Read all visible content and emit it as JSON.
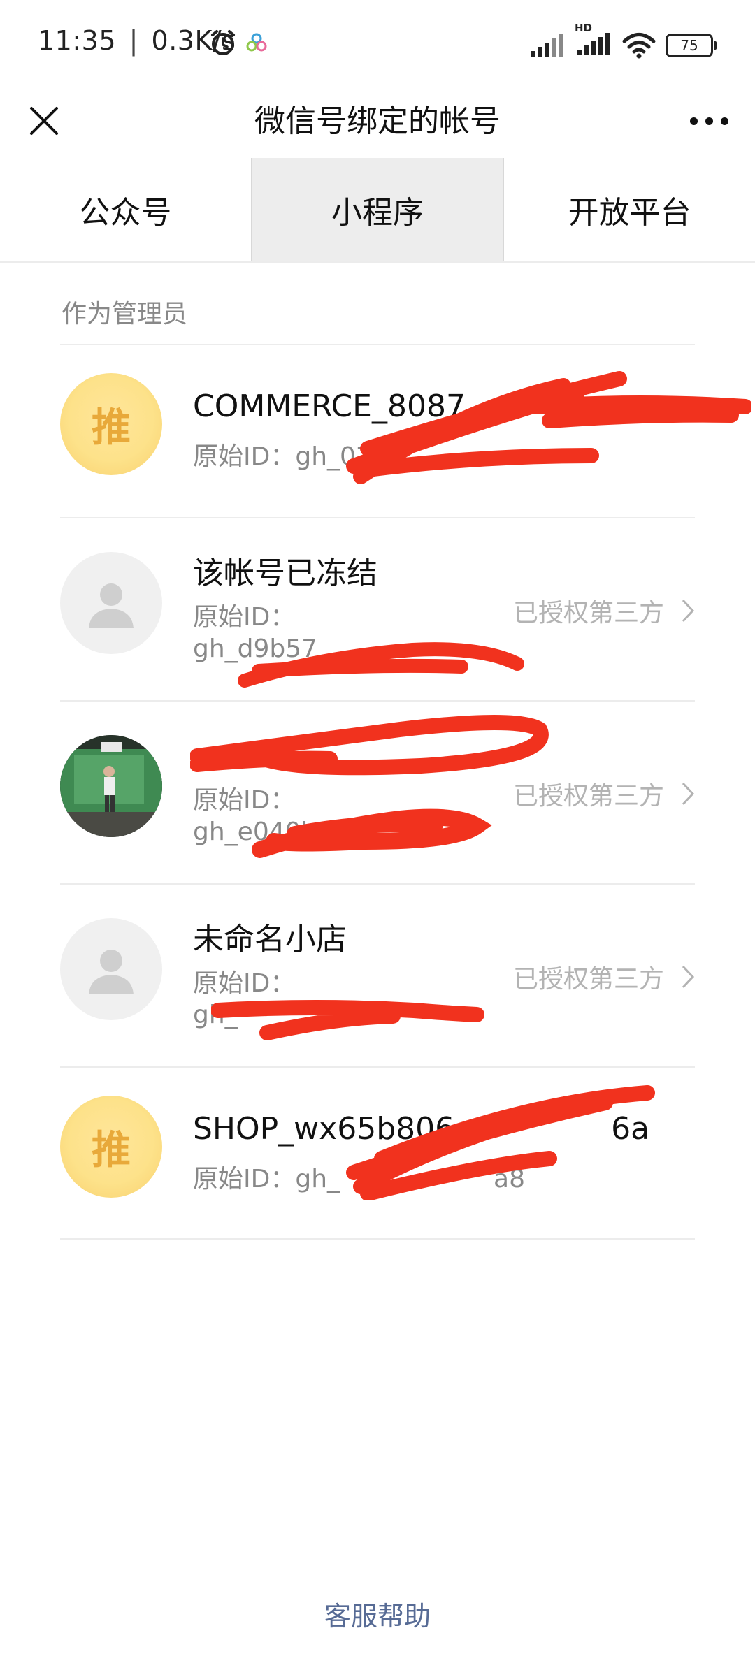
{
  "status_bar": {
    "time": "11:35",
    "speed": "0.3K/s",
    "separator": "|",
    "battery": "75",
    "network_label": "HD",
    "icons": [
      "alarm-icon",
      "cloud-app-icon",
      "signal-icon",
      "hd-signal-icon",
      "wifi-icon",
      "battery-icon"
    ]
  },
  "nav": {
    "title": "微信号绑定的帐号",
    "close_icon": "close-icon",
    "more_icon": "more-icon"
  },
  "tabs": [
    {
      "label": "公众号",
      "active": false
    },
    {
      "label": "小程序",
      "active": true
    },
    {
      "label": "开放平台",
      "active": false
    }
  ],
  "section": {
    "header": "作为管理员"
  },
  "accounts": [
    {
      "name": "COMMERCE_8087",
      "id_label": "原始ID：",
      "id_value": "gh_07",
      "avatar": "推",
      "avatar_type": "tui",
      "status": ""
    },
    {
      "name": "该帐号已冻结",
      "id_label": "原始ID：",
      "id_value": "gh_d9b57",
      "avatar": "",
      "avatar_type": "placeholder",
      "status": "已授权第三方"
    },
    {
      "name": "",
      "id_label": "原始ID：",
      "id_value": "gh_e040b",
      "avatar": "",
      "avatar_type": "photo",
      "status": "已授权第三方"
    },
    {
      "name": "未命名小店",
      "id_label": "原始ID：",
      "id_value": "gh_",
      "avatar": "",
      "avatar_type": "placeholder",
      "status": "已授权第三方"
    },
    {
      "name": "SHOP_wx65b806",
      "name_tail": "6a",
      "id_label": "原始ID：",
      "id_value": "gh_",
      "id_tail": "a8",
      "avatar": "推",
      "avatar_type": "tui",
      "status": ""
    }
  ],
  "footer": {
    "help_link": "客服帮助"
  },
  "colors": {
    "link": "#576b95",
    "secondary_text": "#888888",
    "redaction": "#f1321e",
    "tui_avatar": "#fde28a"
  }
}
